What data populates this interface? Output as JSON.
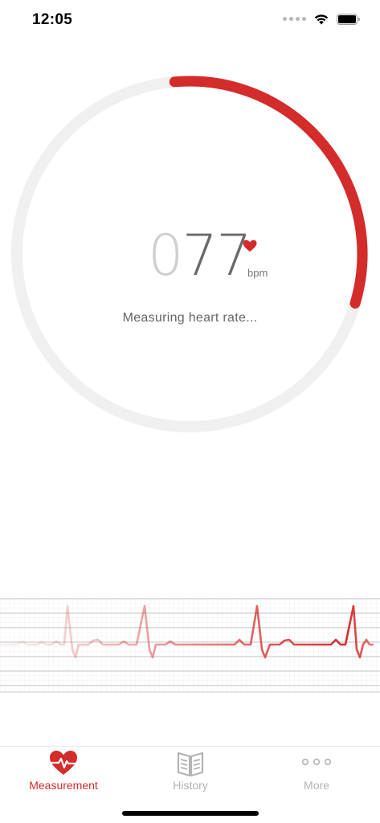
{
  "status_bar": {
    "time": "12:05"
  },
  "gauge": {
    "progress": 0.31,
    "accent_color": "#d42b2b",
    "track_color": "#f0f0f0"
  },
  "reading": {
    "leading_digit": "0",
    "value": "77",
    "unit": "bpm",
    "status_text": "Measuring heart rate..."
  },
  "tabs": [
    {
      "label": "Measurement",
      "icon": "heart-pulse-icon",
      "active": true
    },
    {
      "label": "History",
      "icon": "book-icon",
      "active": false
    },
    {
      "label": "More",
      "icon": "more-dots-icon",
      "active": false
    }
  ]
}
